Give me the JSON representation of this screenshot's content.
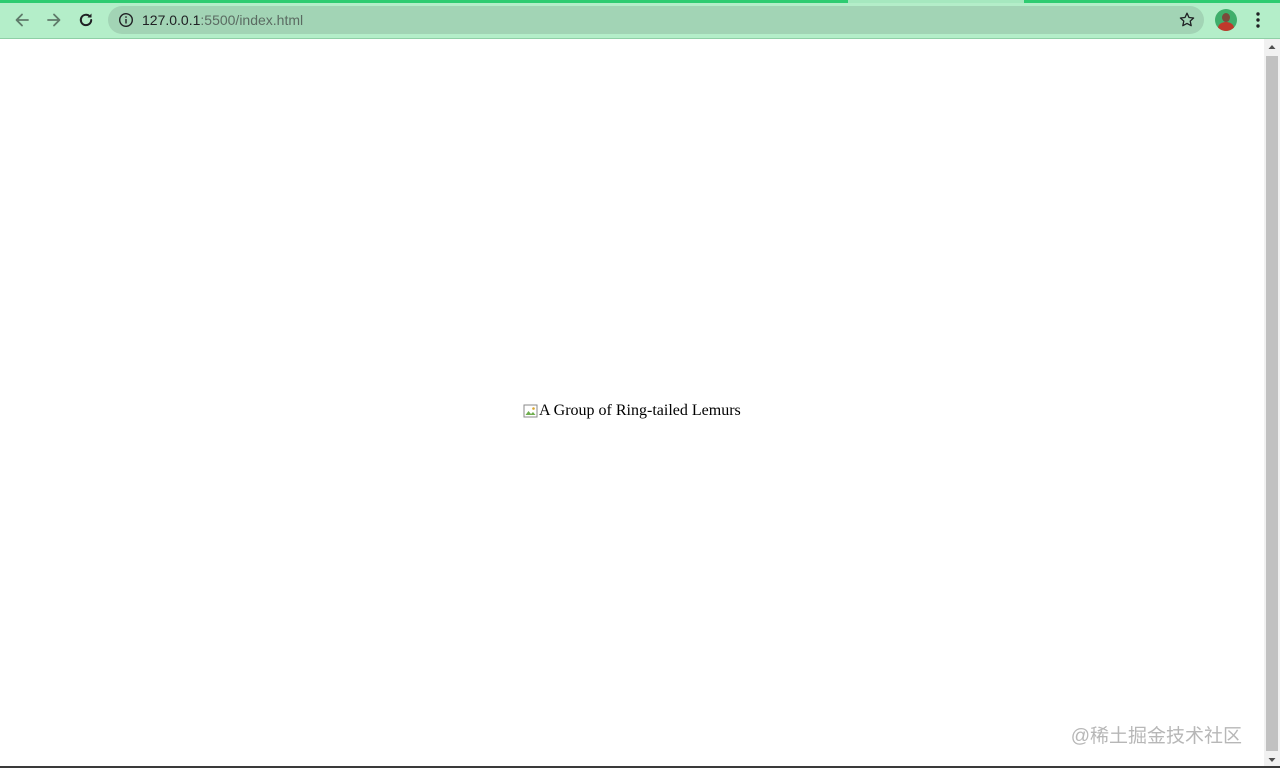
{
  "browser": {
    "accent_color": "#2ecc71",
    "toolbar_color": "#b4eec9",
    "nav": {
      "back_icon": "arrow-left-icon",
      "forward_icon": "arrow-right-icon",
      "reload_icon": "reload-icon"
    },
    "address_bar": {
      "host": "127.0.0.1",
      "path": ":5500/index.html",
      "security_icon": "info-icon",
      "bookmark_icon": "star-icon"
    },
    "profile_icon": "avatar",
    "menu_icon": "kebab-menu-icon"
  },
  "page": {
    "image": {
      "alt_text": "A Group of Ring-tailed Lemurs",
      "icon": "broken-image-icon"
    }
  },
  "watermark": {
    "text": "@稀土掘金技术社区"
  }
}
